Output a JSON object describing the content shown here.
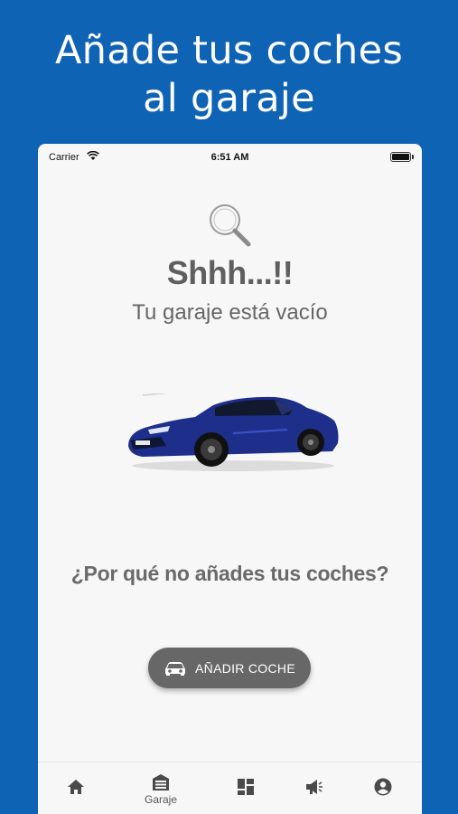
{
  "promo": {
    "line1": "Añade tus coches",
    "line2": "al garaje"
  },
  "status_bar": {
    "carrier": "Carrier",
    "time": "6:51 AM"
  },
  "empty_state": {
    "title": "Shhh...!!",
    "subtitle": "Tu garaje está vacío",
    "prompt": "¿Por qué no añades tus coches?"
  },
  "add_button": {
    "label": "AÑADIR COCHE",
    "icon": "car-icon"
  },
  "tab_bar": {
    "items": [
      {
        "icon": "home-icon",
        "label": ""
      },
      {
        "icon": "garage-icon",
        "label": "Garaje"
      },
      {
        "icon": "dashboard-icon",
        "label": ""
      },
      {
        "icon": "megaphone-icon",
        "label": ""
      },
      {
        "icon": "account-icon",
        "label": ""
      }
    ]
  },
  "colors": {
    "background": "#0f63b4",
    "button": "#676767",
    "car": "#1d2f8a"
  }
}
